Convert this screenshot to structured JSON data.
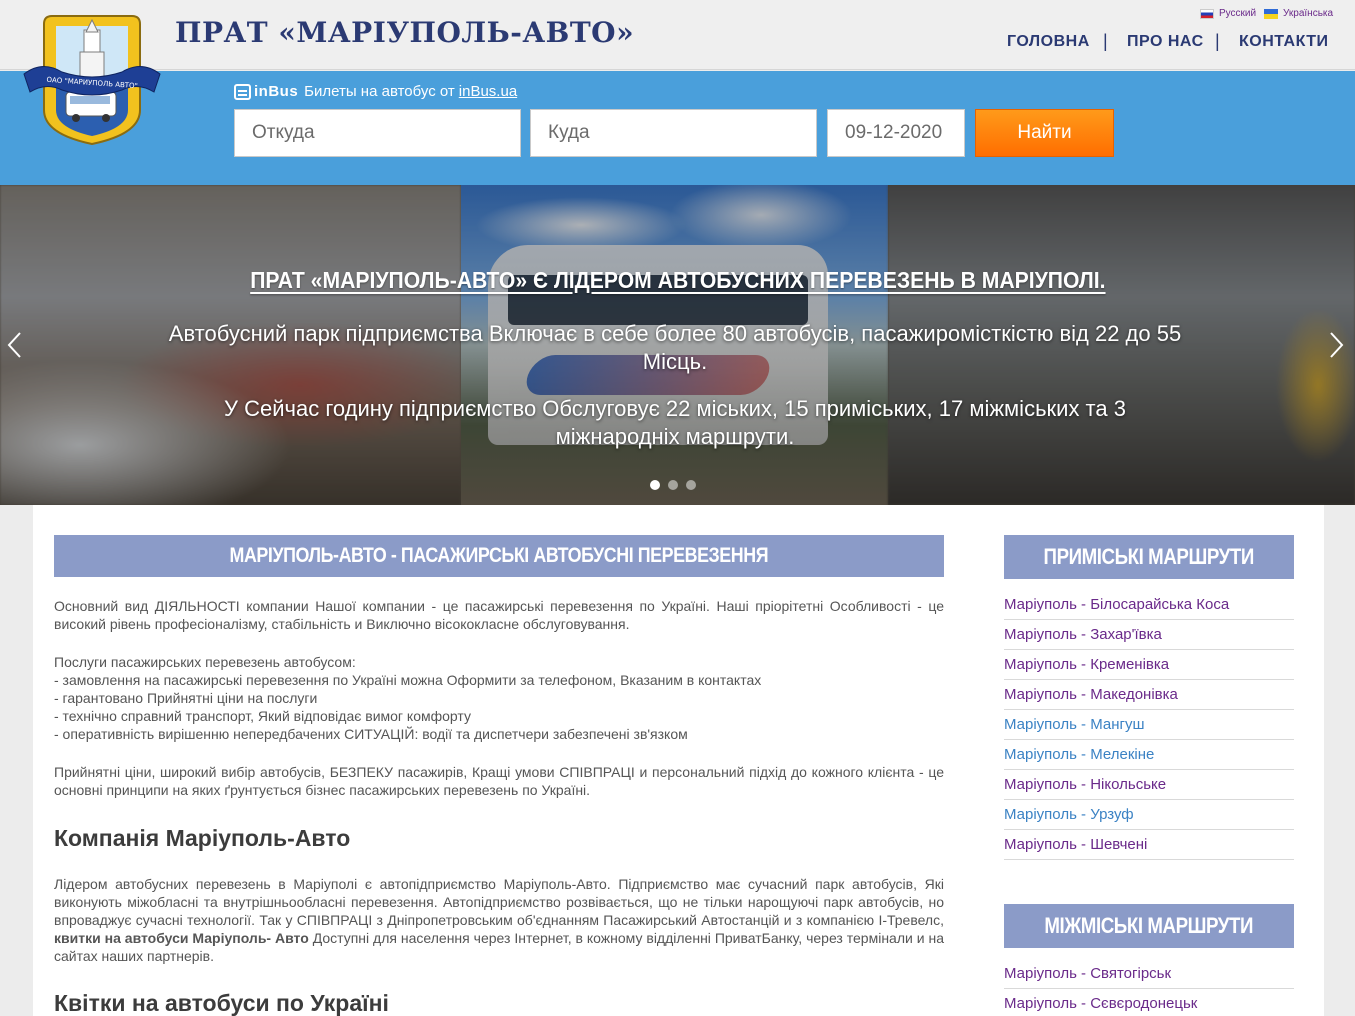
{
  "header": {
    "title": "ПРАТ «МАРІУПОЛЬ-АВТО»",
    "logo_text": "ОАО \"МАРИУПОЛЬ АВТО\"",
    "languages": [
      {
        "label": "Русский",
        "flag": "ru"
      },
      {
        "label": "Українська",
        "flag": "ua"
      }
    ],
    "nav": [
      {
        "label": "ГОЛОВНА"
      },
      {
        "label": "ПРО НАС"
      },
      {
        "label": "КОНТАКТИ"
      }
    ],
    "nav_separator": "|"
  },
  "search": {
    "brand": "inBus",
    "tagline": "Билеты на автобус от",
    "link_text": "inBus.ua",
    "from_placeholder": "Откуда",
    "to_placeholder": "Куда",
    "date_value": "09-12-2020",
    "submit_label": "Найти"
  },
  "slider": {
    "title": "ПРАТ «МАРІУПОЛЬ-АВТО» Є ЛІДЕРОМ АВТОБУСНИХ ПЕРЕВЕЗЕНЬ В МАРІУПОЛІ.",
    "text1": "Автобусний парк підприємства Включає в себе более 80 автобусів, пасажиромісткістю від 22 до 55 Місць.",
    "text2": "У Сейчас годину підприємство Обслуговує 22 міських, 15 приміських, 17 міжміських та 3 міжнародніх маршрути.",
    "active_slide": 1,
    "slide_count": 3
  },
  "content": {
    "heading": "МАРІУПОЛЬ-АВТО - ПАСАЖИРСЬКІ АВТОБУСНІ ПЕРЕВЕЗЕННЯ",
    "p1": "Основний вид ДІЯЛЬНОСТІ компании Нашої компании - це пасажирські перевезення по Україні. Наші пріорітетні Особливості - це високий рівень професіоналізму, стабільність и Виключно вісококласне обслуговування.",
    "services_title": "Послуги пасажирських перевезень автобусом:",
    "services": [
      "- замовлення на пасажирські перевезення по Україні можна Оформити за телефоном, Вказаним в контактах",
      "- гарантовано Прийнятні ціни на послуги",
      "- технічно справний транспорт, Який відповідає вимог комфорту",
      "- оперативність вирішенню непередбачених СИТУАЦІЙ: водії та диспетчери забезпечені зв'язком"
    ],
    "p2": "Прийнятні ціни, широкий вибір автобусів, БЕЗПЕКУ пасажирів, Кращі умови СПІВПРАЦІ и персональний підхід до кожного клієнта - це основні принципи на яких ґрунтується бізнес пасажирських перевезень по Україні.",
    "h_company": "Компанія Маріуполь-Авто",
    "p3_a": "Лідером автобусних перевезень в Маріуполі є автопідприємство Маріуполь-Авто. Підприємство має сучасний парк автобусів, Які виконують міжобласні та внутрішньообласні перевезення. Автопідприємство розвівається, що не тільки нарощуючі парк автобусів, но впроваджує сучасні технології. Так у СПІВПРАЦІ з Дніпропетровським об'єднанням Пасажирський Автостанцій и з компанією І-Тревелс,",
    "p3_bold": "квитки на автобуси Маріуполь- Авто",
    "p3_b": "Доступні для населення через Інтернет, в кожному відділенні ПриватБанку, через термінали и на сайтах наших партнерів.",
    "h_tickets": "Квітки на автобуси по Україні"
  },
  "sidebar": {
    "suburban_title": "ПРИМІСЬКІ МАРШРУТИ",
    "suburban": [
      {
        "label": "Маріуполь - Білосарайська Коса",
        "color": "#6a2a8a"
      },
      {
        "label": "Маріуполь - Захар'ївка",
        "color": "#6a2a8a"
      },
      {
        "label": "Маріуполь - Кременівка",
        "color": "#6a2a8a"
      },
      {
        "label": "Маріуполь - Македонівка",
        "color": "#6a2a8a"
      },
      {
        "label": "Маріуполь - Мангуш",
        "color": "#3b82c4"
      },
      {
        "label": "Маріуполь - Мелекіне",
        "color": "#3b82c4"
      },
      {
        "label": "Маріуполь - Нікольське",
        "color": "#6a2a8a"
      },
      {
        "label": "Маріуполь - Урзуф",
        "color": "#3b82c4"
      },
      {
        "label": "Маріуполь - Шевчені",
        "color": "#6a2a8a"
      }
    ],
    "intercity_title": "МІЖМІСЬКІ МАРШРУТИ",
    "intercity": [
      {
        "label": "Маріуполь - Святогірськ",
        "color": "#6a2a8a"
      },
      {
        "label": "Маріуполь - Сєвєродонецьк",
        "color": "#6a2a8a"
      }
    ]
  },
  "colors": {
    "brand_blue": "#2b3a73",
    "band_blue": "#4a9fdb",
    "accent_orange": "#ff7a00",
    "heading_bar": "#8b9bc8",
    "link_purple": "#6a2a8a"
  }
}
